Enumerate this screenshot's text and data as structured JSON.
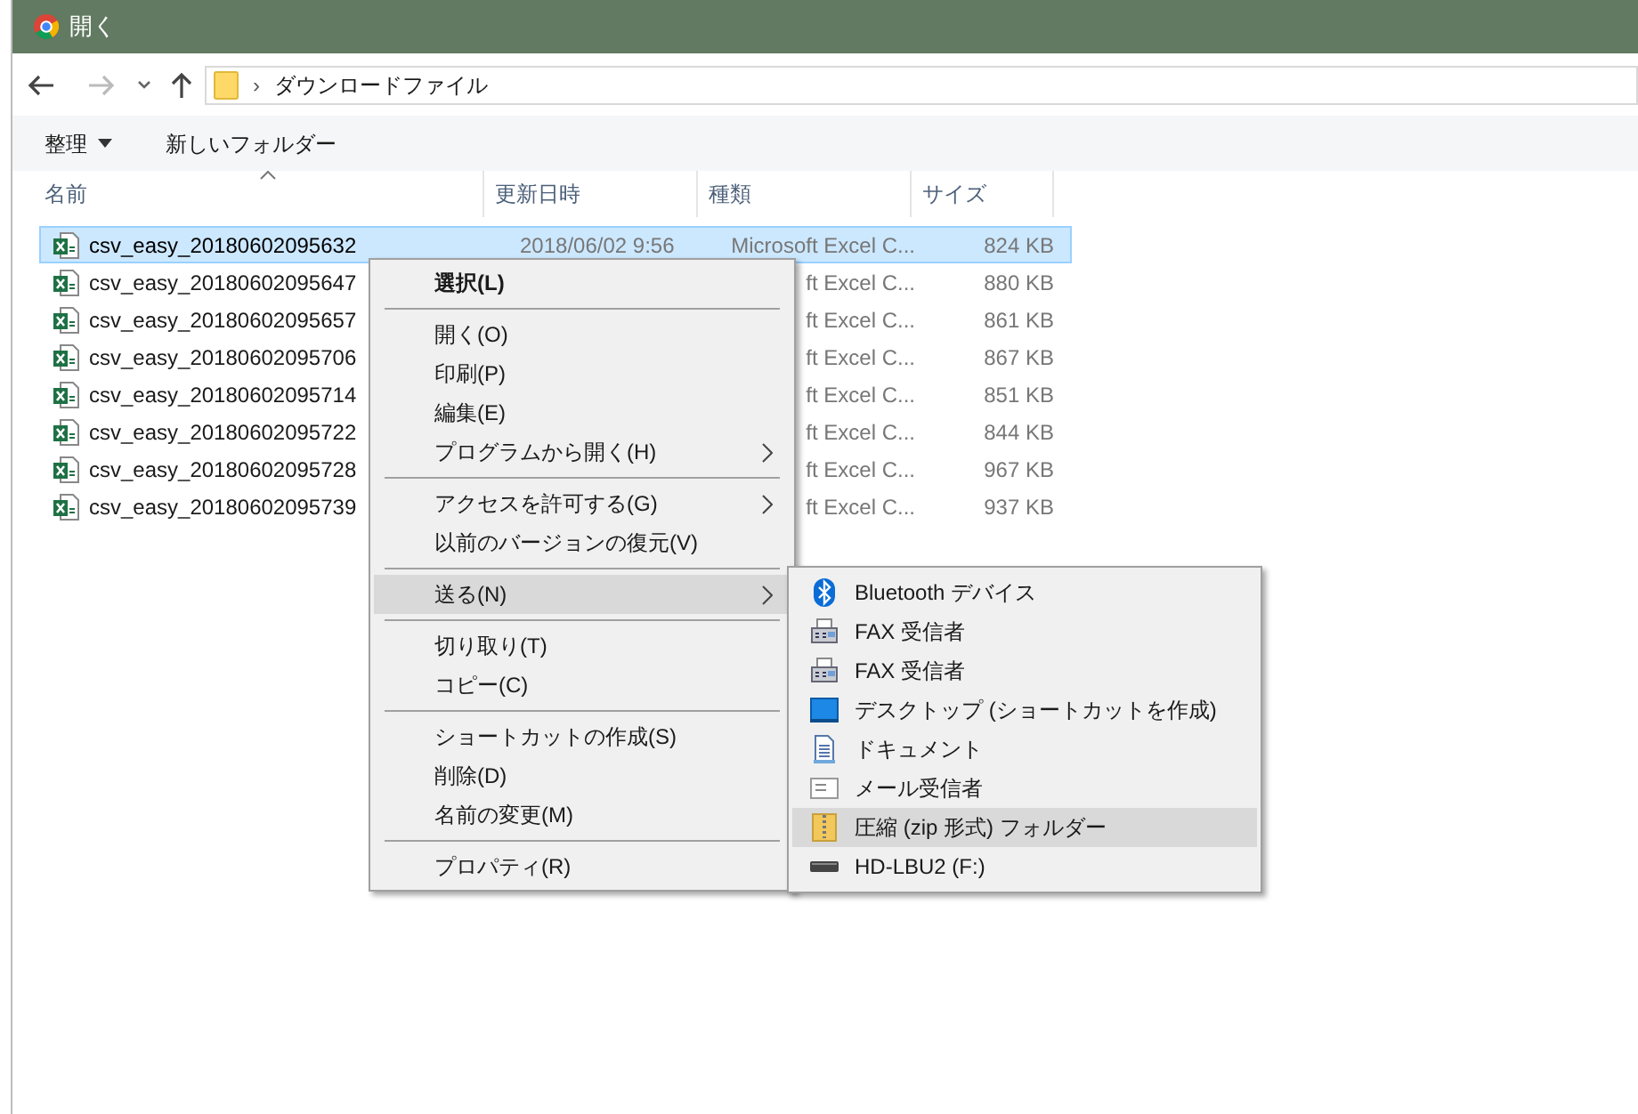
{
  "window": {
    "title": "開く"
  },
  "address": {
    "separator": "›",
    "path": "ダウンロードファイル"
  },
  "toolbar": {
    "organize": "整理",
    "new_folder": "新しいフォルダー"
  },
  "columns": [
    "名前",
    "更新日時",
    "種類",
    "サイズ"
  ],
  "files": [
    {
      "name": "csv_easy_20180602095632",
      "date": "2018/06/02 9:56",
      "type": "Microsoft Excel C...",
      "size": "824 KB",
      "selected": true
    },
    {
      "name": "csv_easy_20180602095647",
      "type": "ft Excel C...",
      "size": "880 KB",
      "selected": false
    },
    {
      "name": "csv_easy_20180602095657",
      "type": "ft Excel C...",
      "size": "861 KB",
      "selected": false
    },
    {
      "name": "csv_easy_20180602095706",
      "type": "ft Excel C...",
      "size": "867 KB",
      "selected": false
    },
    {
      "name": "csv_easy_20180602095714",
      "type": "ft Excel C...",
      "size": "851 KB",
      "selected": false
    },
    {
      "name": "csv_easy_20180602095722",
      "type": "ft Excel C...",
      "size": "844 KB",
      "selected": false
    },
    {
      "name": "csv_easy_20180602095728",
      "type": "ft Excel C...",
      "size": "967 KB",
      "selected": false
    },
    {
      "name": "csv_easy_20180602095739",
      "type": "ft Excel C...",
      "size": "937 KB",
      "selected": false
    }
  ],
  "context_menu": [
    {
      "kind": "item",
      "label": "選択(L)",
      "default": true,
      "submenu": false,
      "selected": false
    },
    {
      "kind": "separator"
    },
    {
      "kind": "item",
      "label": "開く(O)",
      "default": false,
      "submenu": false,
      "selected": false
    },
    {
      "kind": "item",
      "label": "印刷(P)",
      "default": false,
      "submenu": false,
      "selected": false
    },
    {
      "kind": "item",
      "label": "編集(E)",
      "default": false,
      "submenu": false,
      "selected": false
    },
    {
      "kind": "item",
      "label": "プログラムから開く(H)",
      "default": false,
      "submenu": true,
      "selected": false
    },
    {
      "kind": "separator"
    },
    {
      "kind": "item",
      "label": "アクセスを許可する(G)",
      "default": false,
      "submenu": true,
      "selected": false
    },
    {
      "kind": "item",
      "label": "以前のバージョンの復元(V)",
      "default": false,
      "submenu": false,
      "selected": false
    },
    {
      "kind": "separator"
    },
    {
      "kind": "item",
      "label": "送る(N)",
      "default": false,
      "submenu": true,
      "selected": true
    },
    {
      "kind": "separator"
    },
    {
      "kind": "item",
      "label": "切り取り(T)",
      "default": false,
      "submenu": false,
      "selected": false
    },
    {
      "kind": "item",
      "label": "コピー(C)",
      "default": false,
      "submenu": false,
      "selected": false
    },
    {
      "kind": "separator"
    },
    {
      "kind": "item",
      "label": "ショートカットの作成(S)",
      "default": false,
      "submenu": false,
      "selected": false
    },
    {
      "kind": "item",
      "label": "削除(D)",
      "default": false,
      "submenu": false,
      "selected": false
    },
    {
      "kind": "item",
      "label": "名前の変更(M)",
      "default": false,
      "submenu": false,
      "selected": false
    },
    {
      "kind": "separator"
    },
    {
      "kind": "item",
      "label": "プロパティ(R)",
      "default": false,
      "submenu": false,
      "selected": false
    }
  ],
  "send_to_menu": [
    {
      "kind": "bluetooth",
      "label": "Bluetooth デバイス",
      "selected": false
    },
    {
      "kind": "fax",
      "label": "FAX 受信者",
      "selected": false
    },
    {
      "kind": "fax",
      "label": "FAX 受信者",
      "selected": false
    },
    {
      "kind": "desktop",
      "label": "デスクトップ (ショートカットを作成)",
      "selected": false
    },
    {
      "kind": "document",
      "label": "ドキュメント",
      "selected": false
    },
    {
      "kind": "mail",
      "label": "メール受信者",
      "selected": false
    },
    {
      "kind": "zip",
      "label": "圧縮 (zip 形式) フォルダー",
      "selected": true
    },
    {
      "kind": "drive",
      "label": "HD-LBU2 (F:)",
      "selected": false
    }
  ]
}
